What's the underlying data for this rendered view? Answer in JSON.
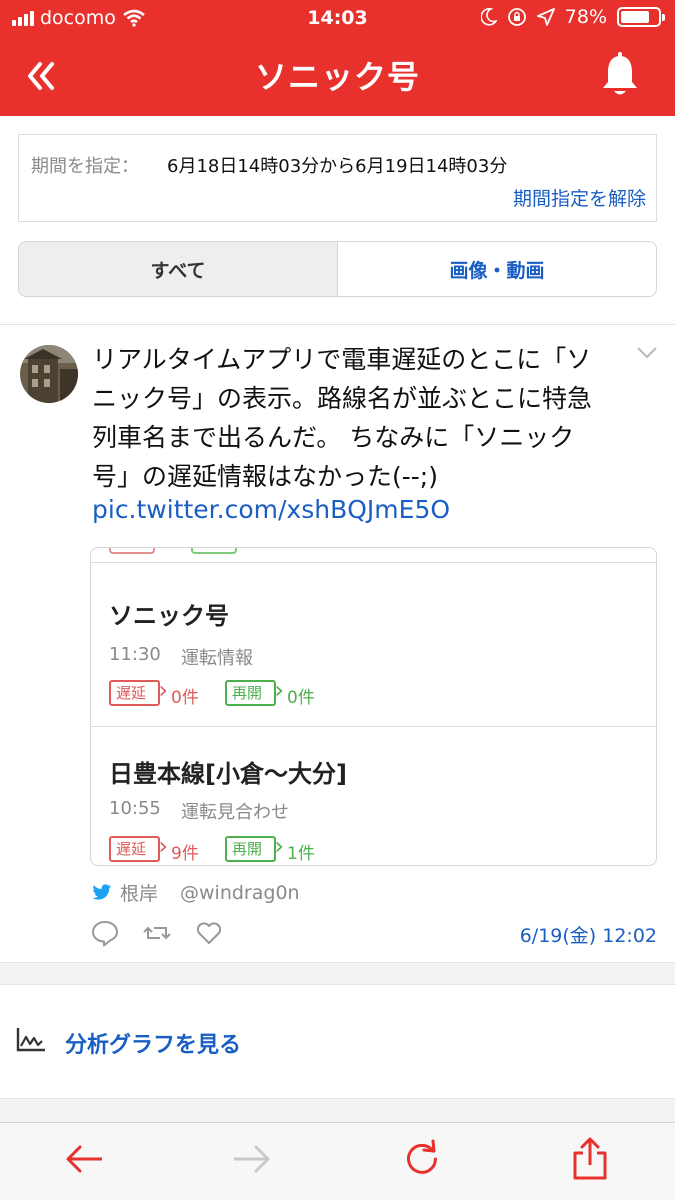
{
  "status_bar": {
    "carrier": "docomo",
    "time": "14:03",
    "battery": "78%",
    "battery_level": 0.78
  },
  "header": {
    "title": "ソニック号",
    "back_icon": "double-chevron-left-icon",
    "bell_icon": "bell-icon",
    "color": "#e8312c"
  },
  "period": {
    "label": "期間を指定：",
    "range": "6月18日14時03分から6月19日14時03分",
    "clear_label": "期間指定を解除"
  },
  "tabs": [
    {
      "label": "すべて",
      "active": true
    },
    {
      "label": "画像・動画",
      "active": false
    }
  ],
  "tweet": {
    "text_lines": [
      "リアルタイムアプリで電車遅延のとこに「ソ",
      "ニック号」の表示。路線名が並ぶとこに特急",
      "列車名まで出るんだ。 ちなみに「ソニック",
      "号」の遅延情報はなかった(--;)"
    ],
    "link": "pic.twitter.com/xshBQJmE5O",
    "author_name": "根岸",
    "author_handle": "@windrag0n",
    "date": "6/19(金) 12:02",
    "embed": {
      "items": [
        {
          "name": "ソニック号",
          "time": "11:30",
          "status": "運転情報",
          "delay_label": "遅延",
          "delay_count": "0件",
          "resume_label": "再開",
          "resume_count": "0件"
        },
        {
          "name": "日豊本線[小倉〜大分]",
          "time": "10:55",
          "status": "運転見合わせ",
          "delay_label": "遅延",
          "delay_count": "9件",
          "resume_label": "再開",
          "resume_count": "1件"
        }
      ]
    }
  },
  "analysis": {
    "label": "分析グラフを見る"
  },
  "colors": {
    "accent": "#e8312c",
    "link": "#1a5ec4",
    "delay": "#e05a5a",
    "resume": "#4db04d"
  }
}
